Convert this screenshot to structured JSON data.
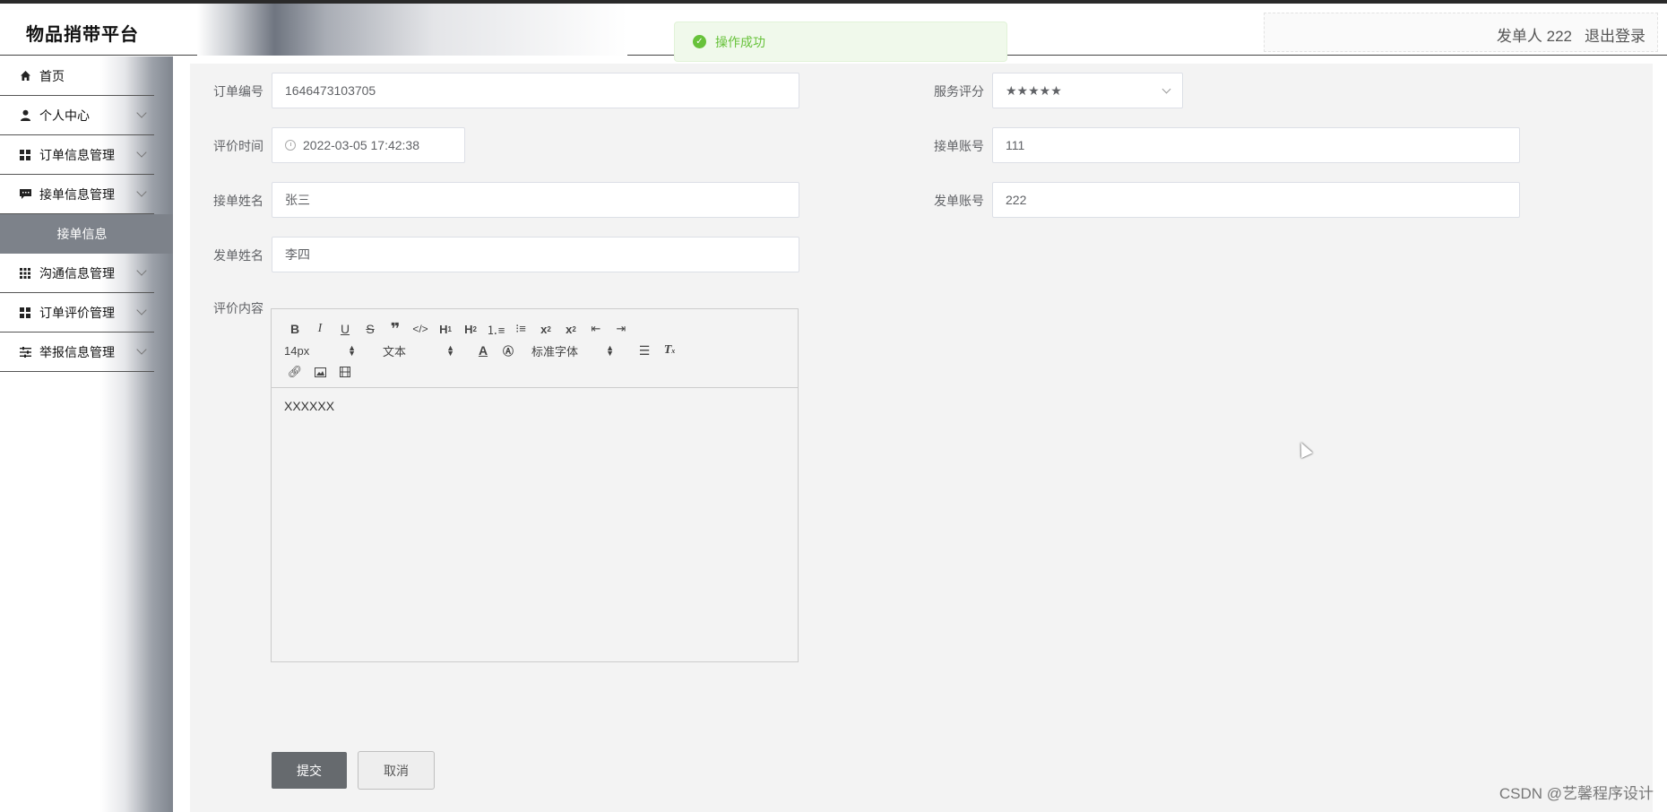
{
  "app": {
    "title": "物品捎带平台"
  },
  "header": {
    "user_label": "发单人 222",
    "logout_label": "退出登录"
  },
  "toast": {
    "icon": "check-circle-icon",
    "message": "操作成功"
  },
  "sidebar": {
    "items": [
      {
        "label": "首页",
        "icon": "home-icon"
      },
      {
        "label": "个人中心",
        "icon": "user-icon"
      },
      {
        "label": "订单信息管理",
        "icon": "grid-icon"
      },
      {
        "label": "接单信息管理",
        "icon": "message-icon"
      },
      {
        "label": "沟通信息管理",
        "icon": "apps-icon"
      },
      {
        "label": "订单评价管理",
        "icon": "grid-icon"
      },
      {
        "label": "举报信息管理",
        "icon": "sliders-icon"
      }
    ],
    "active_submenu": "接单信息"
  },
  "form": {
    "order_no": {
      "label": "订单编号",
      "value": "1646473103705"
    },
    "rating": {
      "label": "服务评分",
      "value": "★★★★★"
    },
    "eval_time": {
      "label": "评价时间",
      "value": "2022-03-05 17:42:38"
    },
    "taker_account": {
      "label": "接单账号",
      "value": "111"
    },
    "taker_name": {
      "label": "接单姓名",
      "value": "张三"
    },
    "sender_account": {
      "label": "发单账号",
      "value": "222"
    },
    "sender_name": {
      "label": "发单姓名",
      "value": "李四"
    },
    "content": {
      "label": "评价内容",
      "value": "XXXXXX"
    }
  },
  "editor": {
    "size_picker": "14px",
    "header_picker": "文本",
    "font_picker": "标准字体"
  },
  "buttons": {
    "submit": "提交",
    "cancel": "取消"
  },
  "watermark": "CSDN @艺馨程序设计",
  "colors": {
    "success": "#67c23a",
    "primary_button": "#666a6e",
    "submenu_active": "#7d828a"
  }
}
